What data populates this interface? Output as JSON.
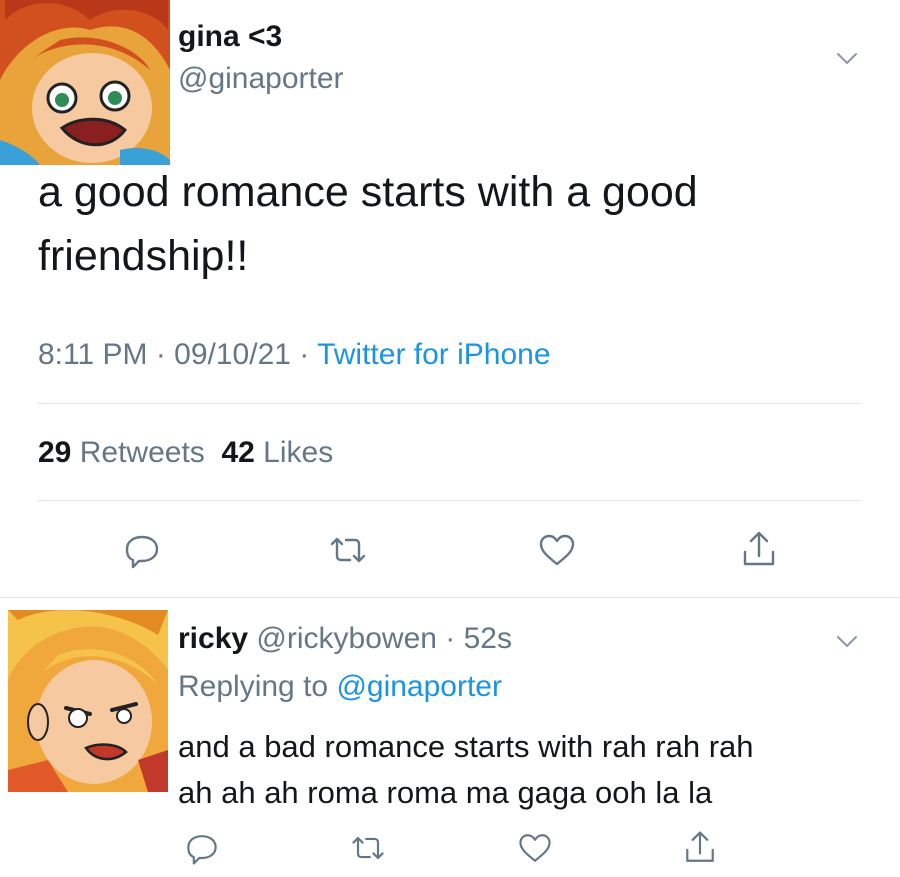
{
  "tweet": {
    "display_name": "gina <3",
    "handle": "@ginaporter",
    "text": "a good romance starts with a good friendship!!",
    "time": "8:11 PM",
    "date": "09/10/21",
    "source": "Twitter for iPhone",
    "retweets_count": "29",
    "retweets_label": "Retweets",
    "likes_count": "42",
    "likes_label": "Likes"
  },
  "reply": {
    "display_name": "ricky",
    "handle": "@rickybowen",
    "age": "52s",
    "replying_prefix": "Replying to",
    "replying_to": "@ginaporter",
    "text_line1": "and a bad romance starts with rah rah rah",
    "text_line2": "ah ah ah roma roma ma gaga ooh la la"
  },
  "icons": {
    "more": "chevron-down-icon",
    "reply": "comment-icon",
    "retweet": "retweet-icon",
    "like": "heart-icon",
    "share": "share-icon"
  },
  "colors": {
    "text": "#14171a",
    "secondary": "#657786",
    "link": "#1b95e0",
    "divider": "#e1e8ed"
  }
}
